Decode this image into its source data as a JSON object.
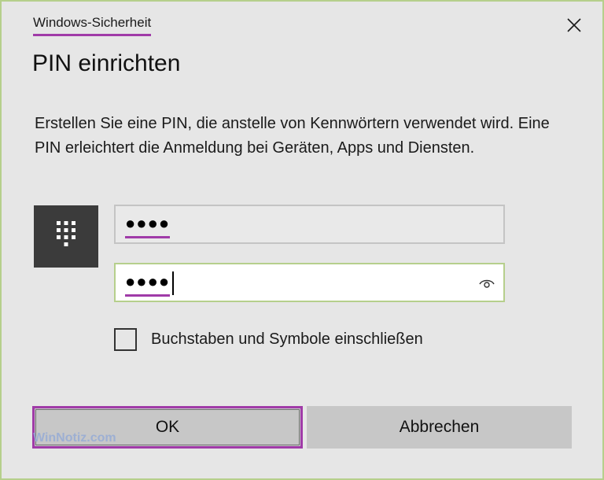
{
  "window": {
    "title": "Windows-Sicherheit"
  },
  "dialog": {
    "heading": "PIN einrichten",
    "description": "Erstellen Sie eine PIN, die anstelle von Kennwörtern verwendet wird. Eine PIN erleichtert die Anmeldung bei Geräten, Apps und Diensten."
  },
  "pin_field": {
    "masked_value": "●●●●"
  },
  "confirm_pin_field": {
    "masked_value": "●●●●"
  },
  "checkbox": {
    "label": "Buchstaben und Symbole einschließen",
    "checked": false
  },
  "buttons": {
    "ok_label": "OK",
    "cancel_label": "Abbrechen"
  },
  "watermark": {
    "text": "WinNotiz.com"
  },
  "icons": {
    "close": "close-icon",
    "keypad": "keypad-icon",
    "reveal": "eye-icon"
  },
  "colors": {
    "dialog_background": "#e6e6e6",
    "dialog_border": "#b6cf8c",
    "highlight": "#a03ba8",
    "pin_tile": "#3b3b3b",
    "button": "#c7c7c7"
  }
}
